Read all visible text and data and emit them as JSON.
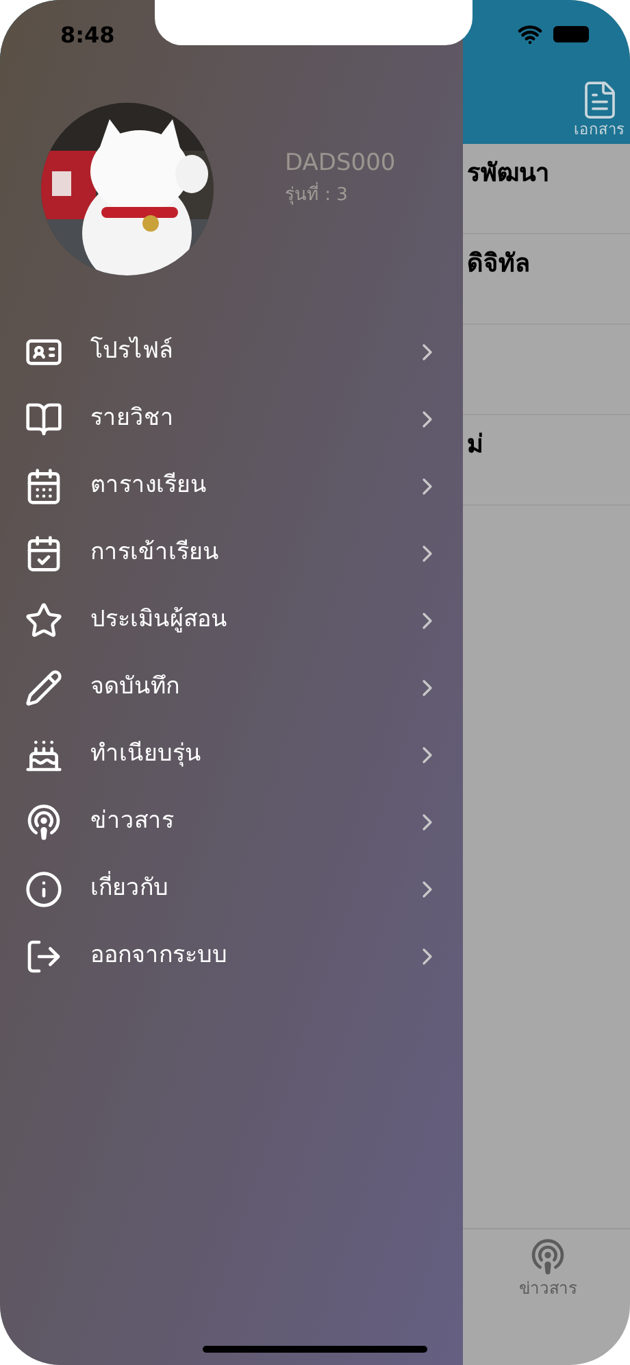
{
  "status_bar": {
    "time": "8:48"
  },
  "profile": {
    "username": "DADS000",
    "batch": "รุ่นที่ : 3"
  },
  "menu": [
    {
      "kind": "profile",
      "label": "โปรไฟล์"
    },
    {
      "kind": "courses",
      "label": "รายวิชา"
    },
    {
      "kind": "schedule",
      "label": "ตารางเรียน"
    },
    {
      "kind": "attendance",
      "label": "การเข้าเรียน"
    },
    {
      "kind": "evaluate",
      "label": "ประเมินผู้สอน"
    },
    {
      "kind": "notes",
      "label": "จดบันทึก"
    },
    {
      "kind": "class",
      "label": "ทำเนียบรุ่น"
    },
    {
      "kind": "news",
      "label": "ข่าวสาร"
    },
    {
      "kind": "about",
      "label": "เกี่ยวกับ"
    },
    {
      "kind": "logout",
      "label": "ออกจากระบบ"
    }
  ],
  "background_screen": {
    "header_action": "เอกสาร",
    "rows": [
      {
        "title": "รพัฒนา"
      },
      {
        "title": "ดิจิทัล"
      },
      {},
      {
        "title": "ม่"
      }
    ],
    "tab_bar": [
      {
        "label": "ข่าวสาร"
      }
    ]
  }
}
